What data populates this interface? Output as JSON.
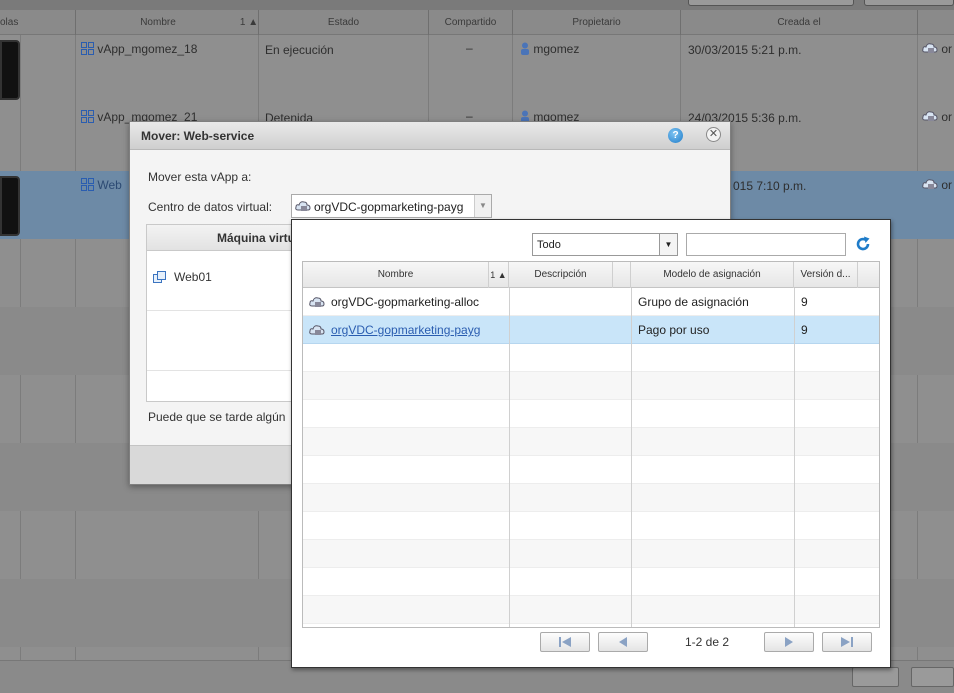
{
  "background_table": {
    "headers": {
      "consolas": "olas",
      "nombre": "Nombre",
      "sort_indicator": "1 ▲",
      "estado": "Estado",
      "compartido": "Compartido",
      "propietario": "Propietario",
      "creada_el": "Creada el"
    },
    "rows": [
      {
        "nombre": "vApp_mgomez_18",
        "estado": "En ejecución",
        "compartido": "–",
        "propietario": "mgomez",
        "creada_el": "30/03/2015 5:21 p.m.",
        "vdc": "or"
      },
      {
        "nombre": "vApp_mgomez_21",
        "estado": "Detenida",
        "compartido": "–",
        "propietario": "mgomez",
        "creada_el": "24/03/2015 5:36 p.m.",
        "vdc": "or"
      },
      {
        "nombre": "Web",
        "estado": "",
        "compartido": "",
        "propietario": "",
        "creada_el": "015 7:10 p.m.",
        "vdc": "or"
      }
    ]
  },
  "dialog": {
    "title": "Mover: Web-service",
    "help_label": "?",
    "close_label": "✕",
    "move_label": "Mover esta vApp a:",
    "vdc_label": "Centro de datos virtual:",
    "vdc_selected": "orgVDC-gopmarketing-payg",
    "vm_column_header": "Máquina virtual",
    "vm_rows": [
      "Web01"
    ],
    "note": "Puede que se tarde algún"
  },
  "popup": {
    "filter_value": "Todo",
    "search_value": "",
    "columns": {
      "nombre": "Nombre",
      "sort": "1 ▲",
      "descripcion": "Descripción",
      "modelo": "Modelo de asignación",
      "version": "Versión d..."
    },
    "rows": [
      {
        "nombre": "orgVDC-gopmarketing-alloc",
        "descripcion": "",
        "modelo": "Grupo de asignación",
        "version": "9",
        "selected": false
      },
      {
        "nombre": "orgVDC-gopmarketing-payg",
        "descripcion": "",
        "modelo": "Pago por uso",
        "version": "9",
        "selected": true
      }
    ],
    "pager_text": "1-2 de 2"
  },
  "colors": {
    "selection": "#c9e5f9",
    "link": "#2a5db0",
    "accent_blue": "#1f7cc9"
  }
}
